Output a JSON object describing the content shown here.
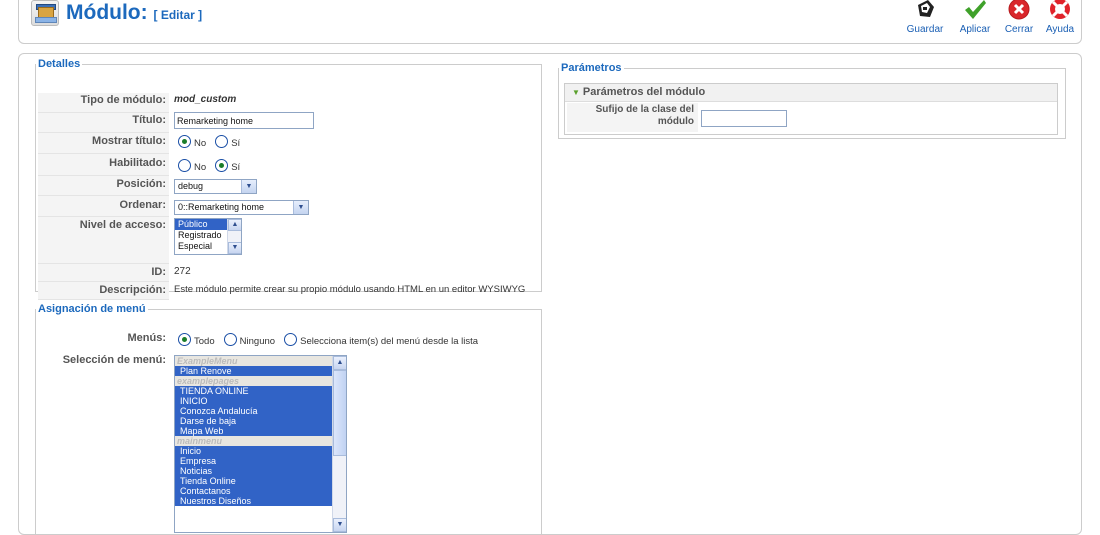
{
  "header": {
    "title": "Módulo:",
    "subtitle": "[ Editar ]"
  },
  "toolbar": {
    "save_label": "Guardar",
    "apply_label": "Aplicar",
    "close_label": "Cerrar",
    "help_label": "Ayuda"
  },
  "details": {
    "legend": "Detalles",
    "module_type_label": "Tipo de módulo:",
    "module_type_value": "mod_custom",
    "title_label": "Título:",
    "title_value": "Remarketing home",
    "show_title_label": "Mostrar título:",
    "show_title_no": "No",
    "show_title_yes": "Sí",
    "show_title_selected": "No",
    "enabled_label": "Habilitado:",
    "enabled_no": "No",
    "enabled_yes": "Sí",
    "enabled_selected": "Sí",
    "position_label": "Posición:",
    "position_value": "debug",
    "order_label": "Ordenar:",
    "order_value": "0::Remarketing home",
    "access_label": "Nivel de acceso:",
    "access_options": [
      "Público",
      "Registrado",
      "Especial"
    ],
    "access_selected": "Público",
    "id_label": "ID:",
    "id_value": "272",
    "description_label": "Descripción:",
    "description_value": "Este módulo permite crear su propio módulo usando HTML en un editor WYSIWYG"
  },
  "menu_assignment": {
    "legend": "Asignación de menú",
    "menus_label": "Menús:",
    "option_all": "Todo",
    "option_none": "Ninguno",
    "option_select": "Selecciona item(s) del menú desde la lista",
    "selected_option": "Todo",
    "selection_label": "Selección de menú:",
    "groups": [
      {
        "name": "ExampleMenu",
        "items": [
          "Plan Renove"
        ]
      },
      {
        "name": "examplepages",
        "items": [
          "TIENDA ONLINE",
          "INICIO",
          "Conozca Andalucía",
          "Darse de baja",
          "Mapa Web"
        ]
      },
      {
        "name": "mainmenu",
        "items": [
          "Inicio",
          "Empresa",
          "Noticias",
          "Tienda Online",
          "Contactanos",
          "Nuestros Diseños"
        ]
      }
    ]
  },
  "parameters": {
    "legend": "Parámetros",
    "panel_title": "Parámetros del módulo",
    "suffix_label_line1": "Sufijo de la clase del",
    "suffix_label_line2": "módulo",
    "suffix_value": ""
  },
  "colors": {
    "accent": "#1c69bd",
    "selection": "#3163c6"
  }
}
